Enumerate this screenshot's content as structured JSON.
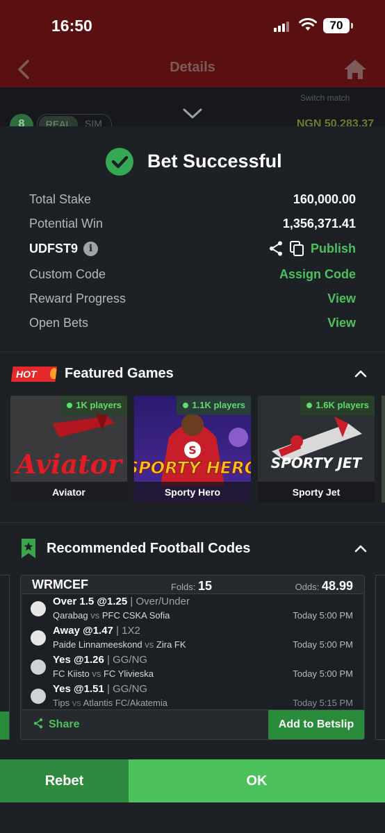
{
  "status": {
    "time": "16:50",
    "battery": "70"
  },
  "appbar": {
    "title": "Details"
  },
  "under": {
    "switch_match": "Switch match",
    "round": "8",
    "mode_real": "REAL",
    "mode_sim": "SIM",
    "balance": "NGN 50,283.37"
  },
  "success": {
    "title": "Bet Successful"
  },
  "summary": {
    "total_stake_label": "Total Stake",
    "total_stake": "160,000.00",
    "potential_win_label": "Potential Win",
    "potential_win": "1,356,371.41",
    "booking_code": "UDFST9",
    "publish": "Publish",
    "custom_code_label": "Custom Code",
    "assign_code": "Assign Code",
    "reward_progress_label": "Reward Progress",
    "reward_view": "View",
    "open_bets_label": "Open Bets",
    "open_bets_view": "View"
  },
  "featured": {
    "badge": "HOT",
    "title": "Featured Games",
    "games": [
      {
        "name": "Aviator",
        "players": "1K players",
        "art_text": "Aviator"
      },
      {
        "name": "Sporty Hero",
        "players": "1.1K players",
        "art_text": "SPORTY HERO"
      },
      {
        "name": "Sporty Jet",
        "players": "1.6K players",
        "art_text": "SPORTY JET"
      }
    ]
  },
  "recommended": {
    "title": "Recommended Football Codes",
    "code": "WRMCEF",
    "folds_label": "Folds:",
    "folds": "15",
    "odds_label": "Odds:",
    "odds": "48.99",
    "selections": [
      {
        "pick": "Over 1.5 @1.25",
        "market": "| Over/Under",
        "home": "Qarabag",
        "away": "PFC CSKA Sofia",
        "time": "Today 5:00 PM"
      },
      {
        "pick": "Away @1.47",
        "market": "| 1X2",
        "home": "Paide Linnameeskond",
        "away": "Zira FK",
        "time": "Today 5:00 PM"
      },
      {
        "pick": "Yes @1.26",
        "market": "| GG/NG",
        "home": "FC Kiisto",
        "away": "FC Ylivieska",
        "time": "Today 5:00 PM"
      },
      {
        "pick": "Yes @1.51",
        "market": "| GG/NG",
        "home": "Tips",
        "away": "Atlantis FC/Akatemia",
        "time": "Today 5:15 PM"
      }
    ],
    "vs": "vs",
    "share": "Share",
    "add_to_betslip": "Add to Betslip"
  },
  "bottom": {
    "rebet": "Rebet",
    "ok": "OK"
  }
}
